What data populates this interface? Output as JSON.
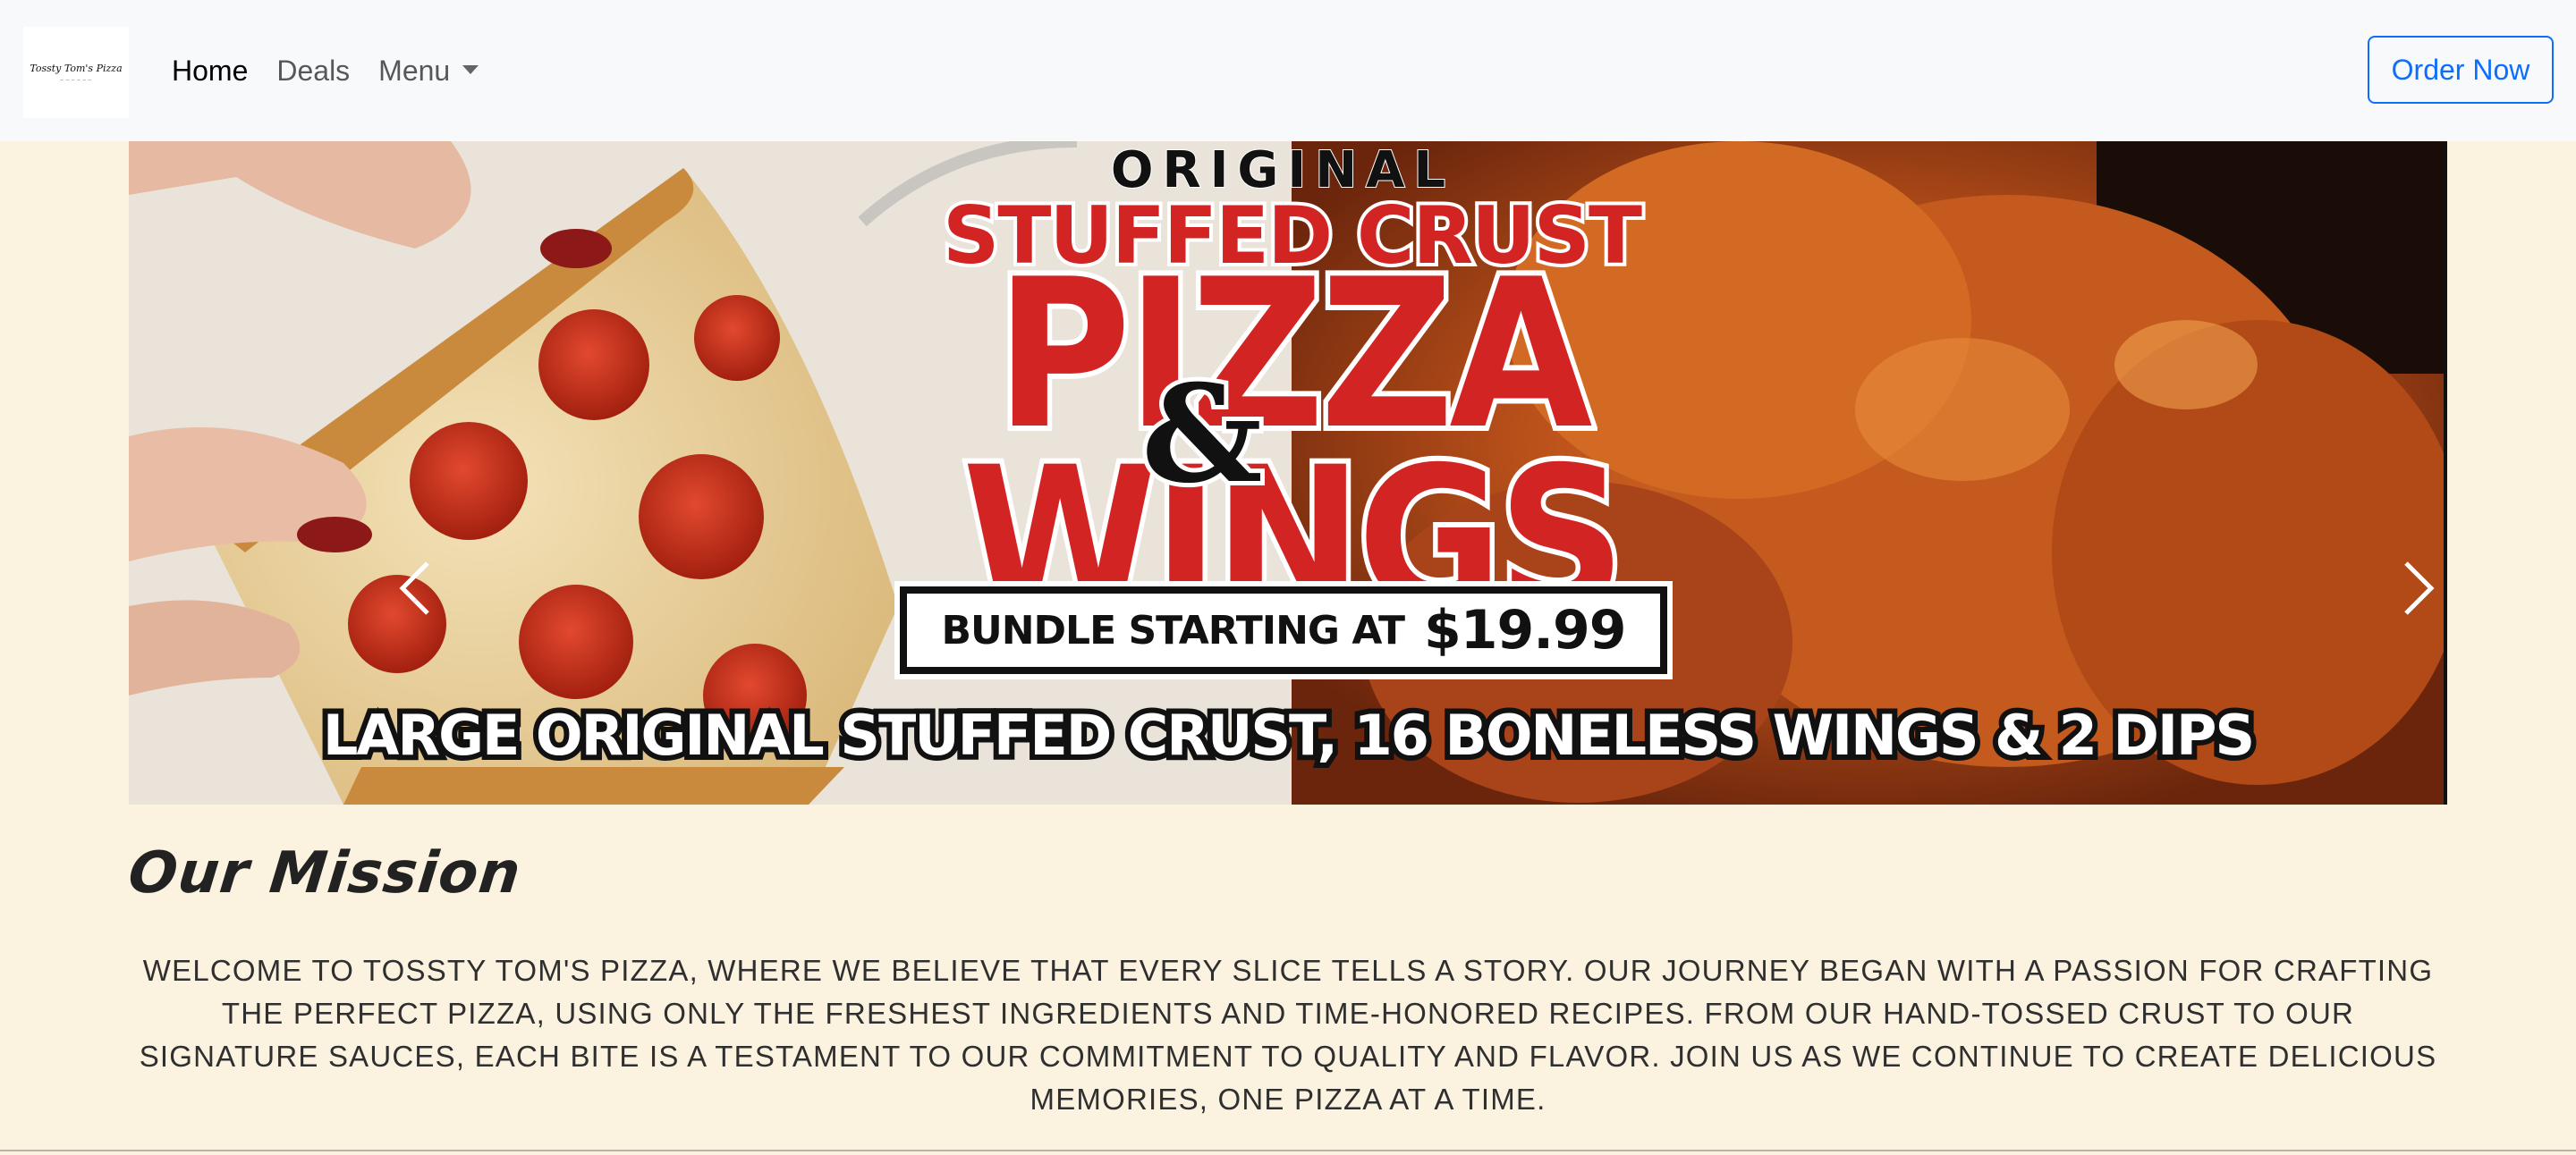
{
  "nav": {
    "brand_name": "Tossty Tom's Pizza",
    "links": [
      {
        "label": "Home",
        "active": true
      },
      {
        "label": "Deals",
        "active": false
      },
      {
        "label": "Menu",
        "active": false,
        "dropdown": true
      }
    ],
    "order_label": "Order Now"
  },
  "carousel": {
    "slide": {
      "line_original": "ORIGINAL",
      "line_stuffed": "STUFFED CRUST",
      "line_pizza": "PIZZA",
      "ampersand": "&",
      "line_wings": "WINGS",
      "bundle_label": "BUNDLE STARTING AT",
      "bundle_price": "$19.99",
      "bottom_line": "LARGE ORIGINAL STUFFED CRUST, 16 BONELESS WINGS & 2 DIPS"
    },
    "prev_icon": "chevron-left-icon",
    "next_icon": "chevron-right-icon"
  },
  "mission": {
    "title": "Our Mission",
    "body": "Welcome to Tossty Tom's Pizza, where we believe that every slice tells a story. Our journey began with a passion for crafting the perfect pizza, using only the freshest ingredients and time-honored recipes. From our hand-tossed crust to our signature sauces, each bite is a testament to our commitment to quality and flavor. Join us as we continue to create delicious memories, one pizza at a time."
  },
  "colors": {
    "page_bg": "#fbf3e0",
    "nav_bg": "#f8f9fa",
    "accent": "#0d6efd",
    "promo_red": "#d32424"
  }
}
